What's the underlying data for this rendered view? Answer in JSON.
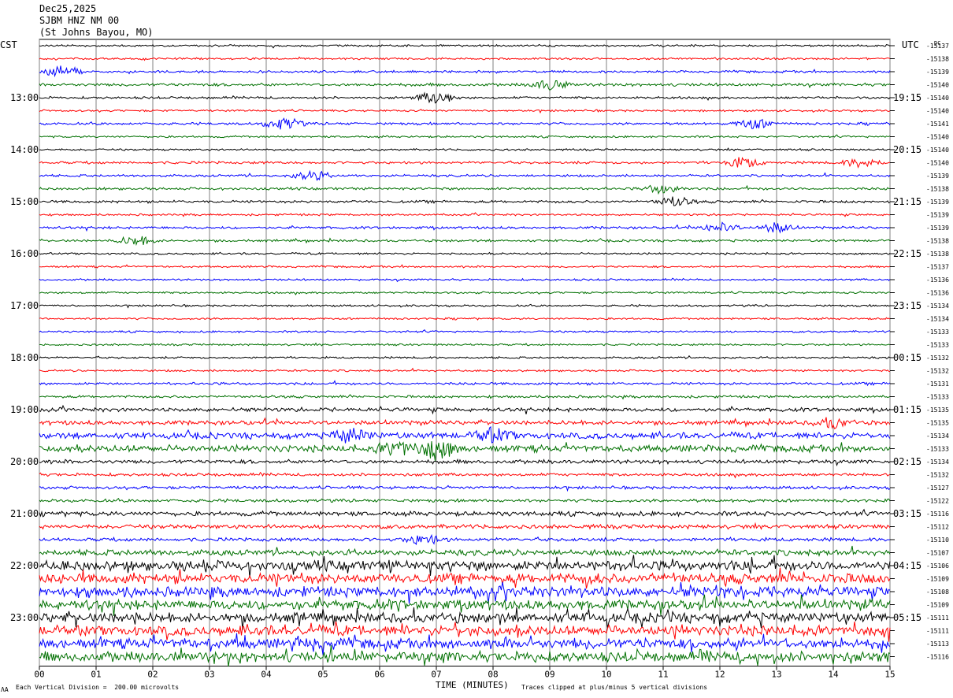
{
  "header": {
    "date": "Dec25,2025",
    "station": "SJBM HNZ NM 00",
    "location": "(St Johns Bayou, MO)"
  },
  "axes": {
    "left_tz": "CST",
    "right_tz": "UTC",
    "dc_label": "DC",
    "xlabel": "TIME (MINUTES)"
  },
  "footer": {
    "scale_note": "Each Vertical Division =  200.00 microvolts",
    "clip_note": "Traces clipped at plus/minus 5 vertical divisions",
    "corner_mark": "ɅA"
  },
  "colors": {
    "cycle": [
      "#000000",
      "#ff0000",
      "#0000ff",
      "#007000"
    ],
    "grid": "#808080"
  },
  "chart_data": {
    "type": "line",
    "title": "SJBM HNZ NM 00",
    "xlim": [
      0,
      15
    ],
    "x_ticks": [
      "00",
      "01",
      "02",
      "03",
      "04",
      "05",
      "06",
      "07",
      "08",
      "09",
      "10",
      "11",
      "12",
      "13",
      "14",
      "15"
    ],
    "cst_hour_labels": [
      {
        "row": 4,
        "label": "13:00"
      },
      {
        "row": 8,
        "label": "14:00"
      },
      {
        "row": 12,
        "label": "15:00"
      },
      {
        "row": 16,
        "label": "16:00"
      },
      {
        "row": 20,
        "label": "17:00"
      },
      {
        "row": 24,
        "label": "18:00"
      },
      {
        "row": 28,
        "label": "19:00"
      },
      {
        "row": 32,
        "label": "20:00"
      },
      {
        "row": 36,
        "label": "21:00"
      },
      {
        "row": 40,
        "label": "22:00"
      },
      {
        "row": 44,
        "label": "23:00"
      }
    ],
    "utc_hour_labels": [
      {
        "row": 4,
        "label": "19:15"
      },
      {
        "row": 8,
        "label": "20:15"
      },
      {
        "row": 12,
        "label": "21:15"
      },
      {
        "row": 16,
        "label": "22:15"
      },
      {
        "row": 20,
        "label": "23:15"
      },
      {
        "row": 24,
        "label": "00:15"
      },
      {
        "row": 28,
        "label": "01:15"
      },
      {
        "row": 32,
        "label": "02:15"
      },
      {
        "row": 36,
        "label": "03:15"
      },
      {
        "row": 40,
        "label": "04:15"
      },
      {
        "row": 44,
        "label": "05:15"
      }
    ],
    "dc_offsets": [
      "-15137",
      "-15138",
      "-15139",
      "-15140",
      "-15140",
      "-15140",
      "-15141",
      "-15140",
      "-15140",
      "-15140",
      "-15139",
      "-15138",
      "-15139",
      "-15139",
      "-15139",
      "-15138",
      "-15138",
      "-15137",
      "-15136",
      "-15136",
      "-15134",
      "-15134",
      "-15133",
      "-15133",
      "-15132",
      "-15132",
      "-15131",
      "-15133",
      "-15135",
      "-15135",
      "-15134",
      "-15133",
      "-15134",
      "-15132",
      "-15127",
      "-15122",
      "-15116",
      "-15112",
      "-15110",
      "-15107",
      "-15106",
      "-15109",
      "-15108",
      "-15109",
      "-15111",
      "-15111",
      "-15113",
      "-15116"
    ],
    "trace_amplitude": [
      1,
      1,
      1.2,
      1.5,
      1.2,
      1,
      1.3,
      1,
      1,
      1.3,
      1.2,
      1.3,
      1.3,
      1,
      1.3,
      1.2,
      1,
      1,
      1,
      1,
      1,
      1,
      1,
      1,
      1,
      1,
      1.3,
      1.3,
      2,
      2.2,
      3.2,
      3.5,
      2,
      1.5,
      1.5,
      1.6,
      2.3,
      2.1,
      1.8,
      3,
      5,
      5,
      5,
      5,
      5,
      5,
      5,
      5
    ],
    "events": [
      {
        "row": 2,
        "minute": 0.4,
        "amp": 4
      },
      {
        "row": 3,
        "minute": 9.0,
        "amp": 3
      },
      {
        "row": 4,
        "minute": 7.0,
        "amp": 4
      },
      {
        "row": 6,
        "minute": 4.3,
        "amp": 4
      },
      {
        "row": 6,
        "minute": 12.6,
        "amp": 3
      },
      {
        "row": 9,
        "minute": 12.4,
        "amp": 3
      },
      {
        "row": 9,
        "minute": 14.5,
        "amp": 3
      },
      {
        "row": 10,
        "minute": 4.8,
        "amp": 3
      },
      {
        "row": 11,
        "minute": 11.0,
        "amp": 3
      },
      {
        "row": 12,
        "minute": 11.2,
        "amp": 3
      },
      {
        "row": 14,
        "minute": 12.0,
        "amp": 3
      },
      {
        "row": 14,
        "minute": 13.0,
        "amp": 3
      },
      {
        "row": 15,
        "minute": 1.7,
        "amp": 3
      },
      {
        "row": 30,
        "minute": 5.5,
        "amp": 4
      },
      {
        "row": 30,
        "minute": 8.0,
        "amp": 4
      },
      {
        "row": 31,
        "minute": 7.0,
        "amp": 6
      },
      {
        "row": 31,
        "minute": 6.3,
        "amp": 4
      },
      {
        "row": 29,
        "minute": 14.0,
        "amp": 3
      },
      {
        "row": 38,
        "minute": 6.8,
        "amp": 3
      }
    ]
  }
}
